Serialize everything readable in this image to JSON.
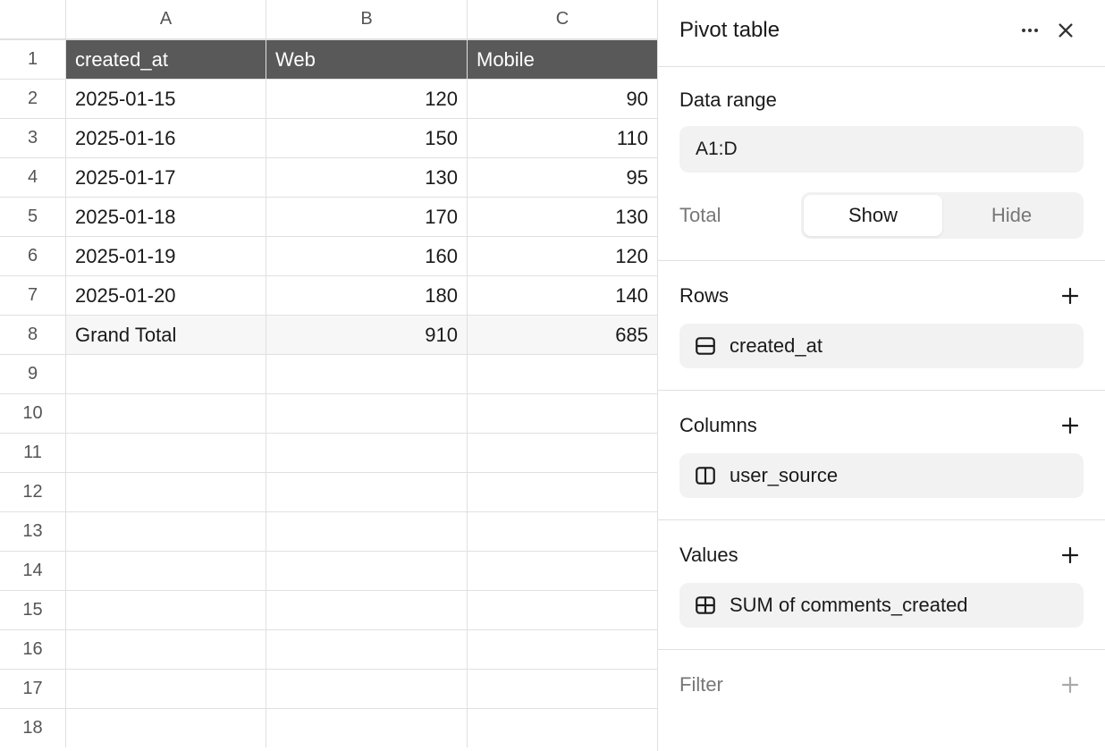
{
  "sheet": {
    "columns": [
      "A",
      "B",
      "C"
    ],
    "row_numbers": [
      1,
      2,
      3,
      4,
      5,
      6,
      7,
      8,
      9,
      10,
      11,
      12,
      13,
      14,
      15,
      16,
      17,
      18
    ],
    "header_row": {
      "A": "created_at",
      "B": "Web",
      "C": "Mobile"
    },
    "data_rows": [
      {
        "A": "2025-01-15",
        "B": "120",
        "C": "90"
      },
      {
        "A": "2025-01-16",
        "B": "150",
        "C": "110"
      },
      {
        "A": "2025-01-17",
        "B": "130",
        "C": "95"
      },
      {
        "A": "2025-01-18",
        "B": "170",
        "C": "130"
      },
      {
        "A": "2025-01-19",
        "B": "160",
        "C": "120"
      },
      {
        "A": "2025-01-20",
        "B": "180",
        "C": "140"
      }
    ],
    "total_row": {
      "A": "Grand Total",
      "B": "910",
      "C": "685"
    }
  },
  "panel": {
    "title": "Pivot table",
    "data_range_label": "Data range",
    "data_range_value": "A1:D",
    "total_label": "Total",
    "show_label": "Show",
    "hide_label": "Hide",
    "rows_label": "Rows",
    "rows_pill": "created_at",
    "columns_label": "Columns",
    "columns_pill": "user_source",
    "values_label": "Values",
    "values_pill": "SUM of comments_created",
    "filter_label": "Filter"
  }
}
